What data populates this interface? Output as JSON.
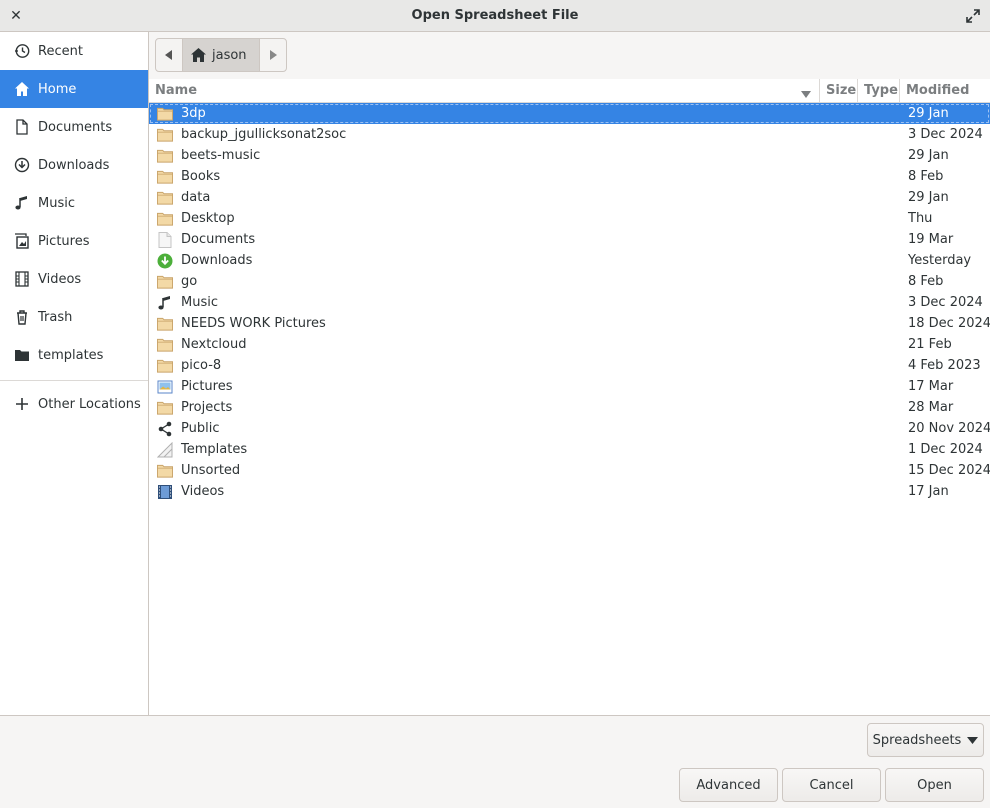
{
  "window": {
    "title": "Open Spreadsheet File"
  },
  "sidebar": {
    "items": [
      {
        "label": "Recent",
        "icon": "clock-icon"
      },
      {
        "label": "Home",
        "icon": "home-icon",
        "selected": true
      },
      {
        "label": "Documents",
        "icon": "document-icon"
      },
      {
        "label": "Downloads",
        "icon": "download-icon"
      },
      {
        "label": "Music",
        "icon": "music-icon"
      },
      {
        "label": "Pictures",
        "icon": "pictures-icon"
      },
      {
        "label": "Videos",
        "icon": "film-icon"
      },
      {
        "label": "Trash",
        "icon": "trash-icon"
      },
      {
        "label": "templates",
        "icon": "folder-icon"
      }
    ],
    "other_locations": "Other Locations"
  },
  "pathbar": {
    "current": "jason"
  },
  "columns": {
    "name": "Name",
    "size": "Size",
    "type": "Type",
    "modified": "Modified"
  },
  "files": [
    {
      "name": "3dp",
      "modified": "29 Jan",
      "icon": "folder-icon",
      "selected": true
    },
    {
      "name": "backup_jgullicksonat2soc",
      "modified": "3 Dec 2024",
      "icon": "folder-icon"
    },
    {
      "name": "beets-music",
      "modified": "29 Jan",
      "icon": "folder-icon"
    },
    {
      "name": "Books",
      "modified": "8 Feb",
      "icon": "folder-icon"
    },
    {
      "name": "data",
      "modified": "29 Jan",
      "icon": "folder-icon"
    },
    {
      "name": "Desktop",
      "modified": "Thu",
      "icon": "folder-icon"
    },
    {
      "name": "Documents",
      "modified": "19 Mar",
      "icon": "document-icon"
    },
    {
      "name": "Downloads",
      "modified": "Yesterday",
      "icon": "download-icon"
    },
    {
      "name": "go",
      "modified": "8 Feb",
      "icon": "folder-icon"
    },
    {
      "name": "Music",
      "modified": "3 Dec 2024",
      "icon": "music-icon"
    },
    {
      "name": "NEEDS WORK Pictures",
      "modified": "18 Dec 2024",
      "icon": "folder-icon"
    },
    {
      "name": "Nextcloud",
      "modified": "21 Feb",
      "icon": "folder-icon"
    },
    {
      "name": "pico-8",
      "modified": "4 Feb 2023",
      "icon": "folder-icon"
    },
    {
      "name": "Pictures",
      "modified": "17 Mar",
      "icon": "pictures-icon"
    },
    {
      "name": "Projects",
      "modified": "28 Mar",
      "icon": "folder-icon"
    },
    {
      "name": "Public",
      "modified": "20 Nov 2024",
      "icon": "share-icon"
    },
    {
      "name": "Templates",
      "modified": "1 Dec 2024",
      "icon": "templates-icon"
    },
    {
      "name": "Unsorted",
      "modified": "15 Dec 2024",
      "icon": "folder-icon"
    },
    {
      "name": "Videos",
      "modified": "17 Jan",
      "icon": "film-icon"
    }
  ],
  "footer": {
    "filter": "Spreadsheets",
    "advanced": "Advanced",
    "cancel": "Cancel",
    "open": "Open"
  },
  "colors": {
    "accent": "#3584e4",
    "folder": "#f0d39a"
  }
}
